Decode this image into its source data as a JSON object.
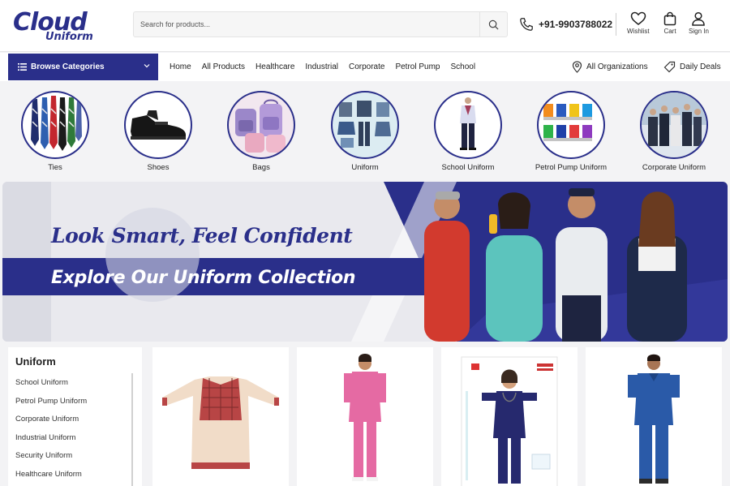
{
  "header": {
    "logo_text_1": "Cloud",
    "logo_text_2": "Uniform",
    "search_placeholder": "Search for products...",
    "phone": "+91-9903788022",
    "wishlist_label": "Wishlist",
    "cart_label": "Cart",
    "signin_label": "Sign In"
  },
  "nav": {
    "browse_label": "Browse Categories",
    "links": [
      "Home",
      "All Products",
      "Healthcare",
      "Industrial",
      "Corporate",
      "Petrol Pump",
      "School"
    ],
    "organizations_label": "All Organizations",
    "deals_label": "Daily Deals"
  },
  "categories": [
    "Ties",
    "Shoes",
    "Bags",
    "Uniform",
    "School Uniform",
    "Petrol Pump Uniform",
    "Corporate Uniform"
  ],
  "banner": {
    "tagline": "Look Smart, Feel Confident",
    "cta": "Explore Our Uniform Collection"
  },
  "sidebar": {
    "title": "Uniform",
    "items": [
      "School Uniform",
      "Petrol Pump Uniform",
      "Corporate Uniform",
      "Industrial Uniform",
      "Security Uniform",
      "Healthcare Uniform"
    ]
  },
  "colors": {
    "brand": "#2a2f8a",
    "page_bg": "#f3f3f5"
  }
}
